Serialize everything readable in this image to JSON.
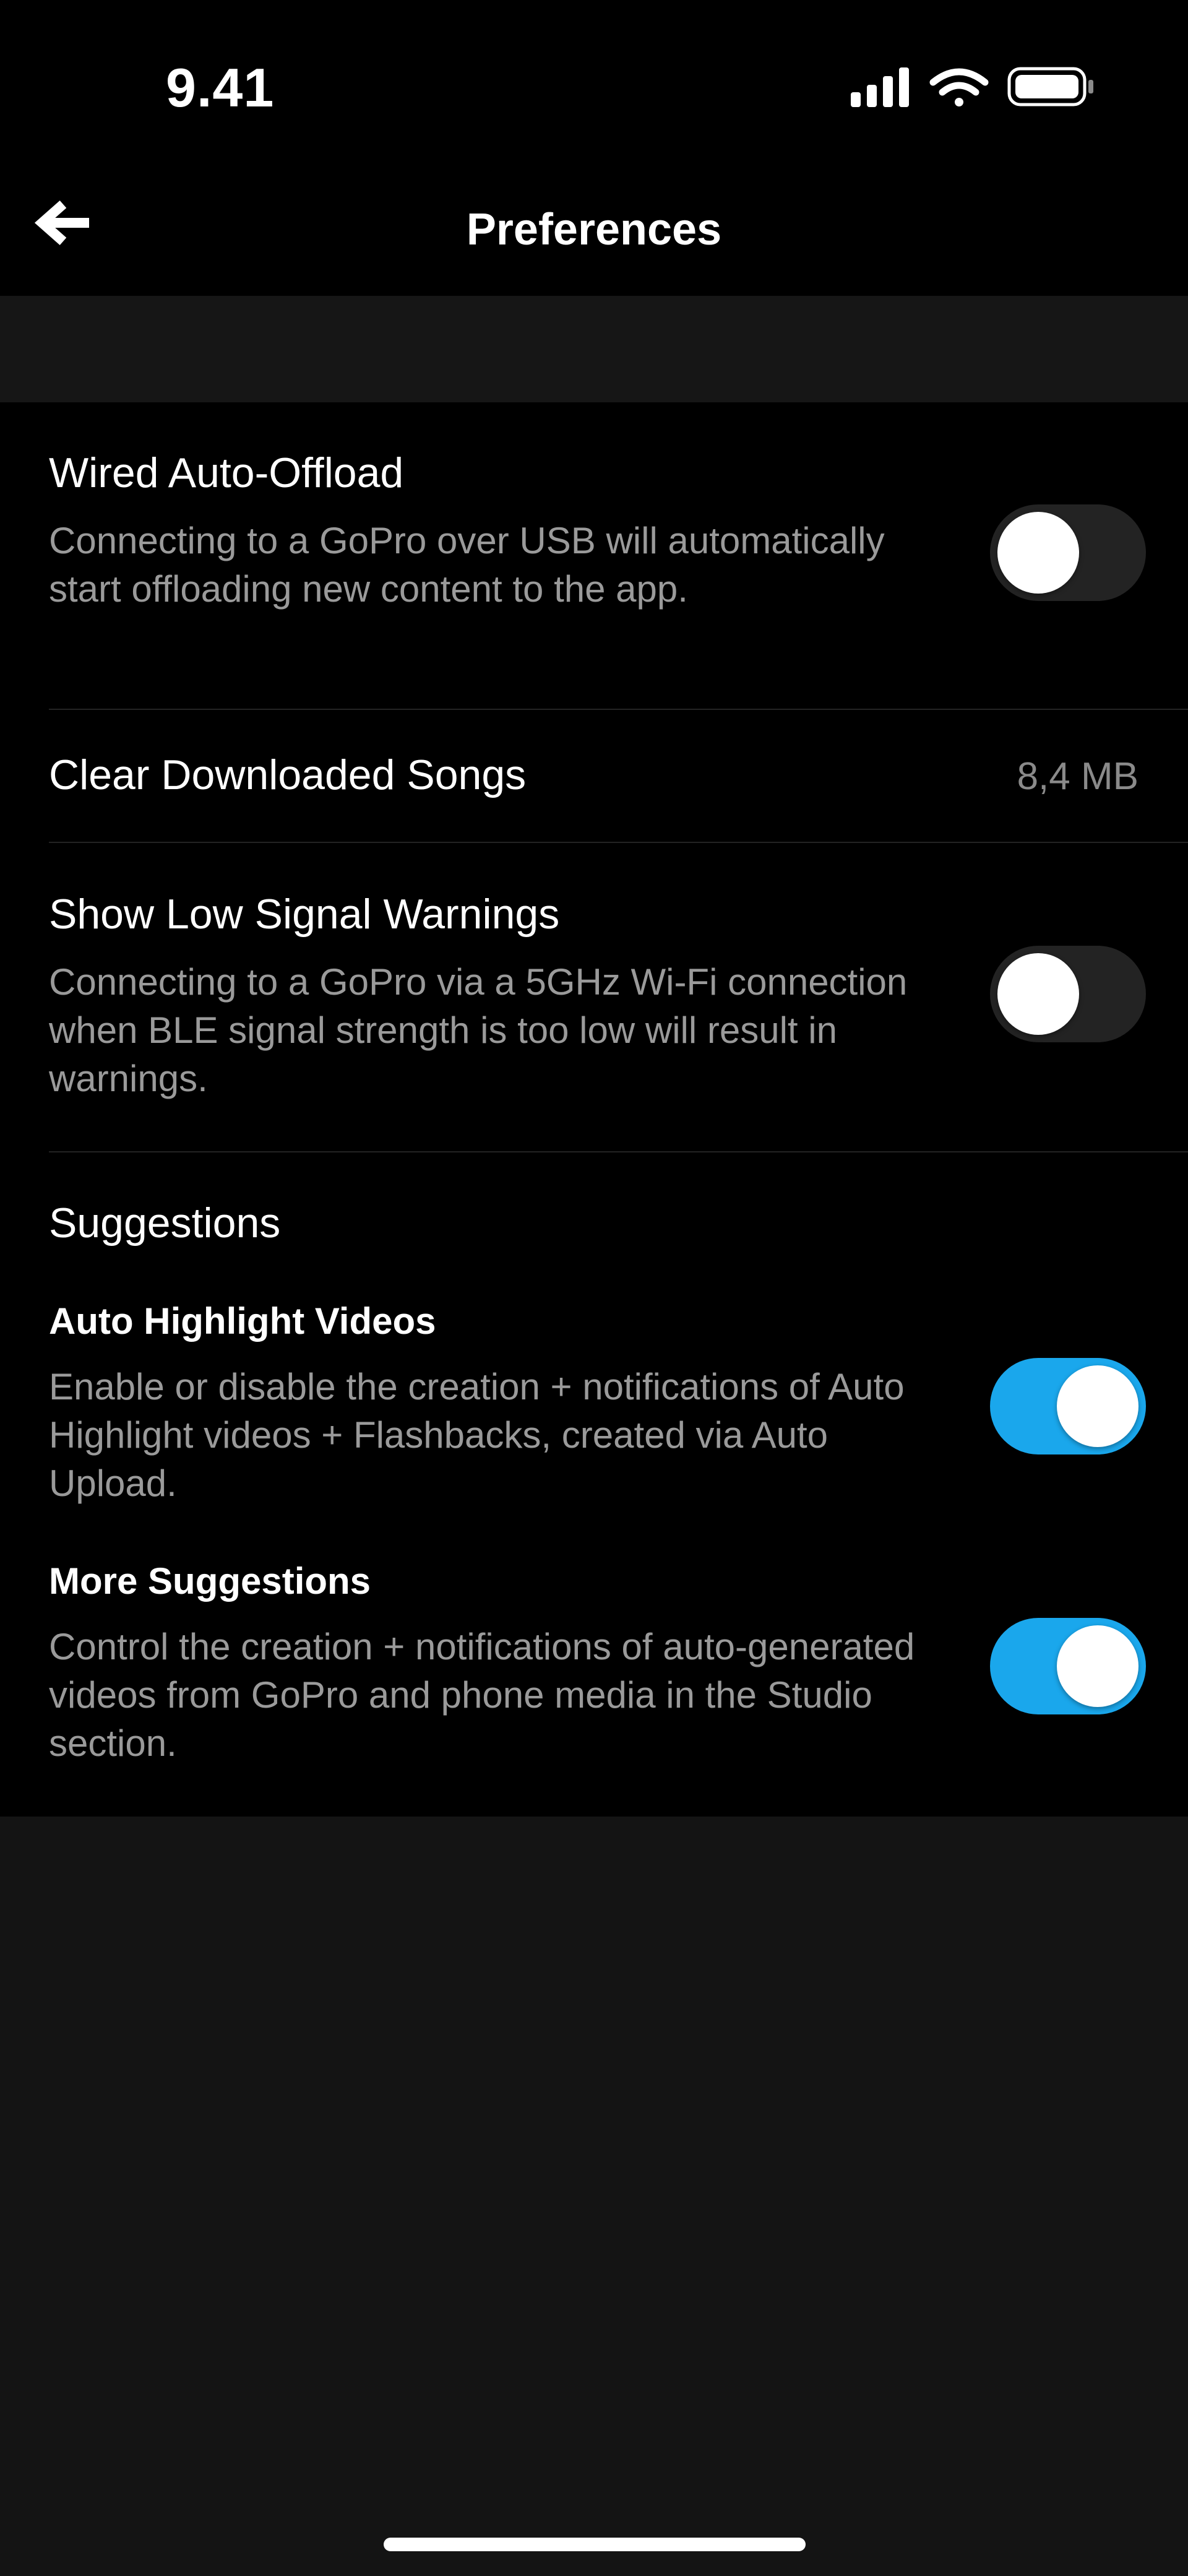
{
  "status_bar": {
    "time": "9.41",
    "icons": [
      "cellular-signal-icon",
      "wifi-icon",
      "battery-icon"
    ]
  },
  "nav": {
    "back_icon": "arrow-left-icon",
    "title": "Preferences"
  },
  "settings": {
    "wired_auto_offload": {
      "title": "Wired Auto-Offload",
      "description": "Connecting to a GoPro over USB will automatically start offloading new content to the app.",
      "enabled": false
    },
    "clear_songs": {
      "title": "Clear Downloaded Songs",
      "value": "8,4 MB"
    },
    "low_signal": {
      "title": "Show Low Signal Warnings",
      "description": "Connecting to a GoPro via a 5GHz Wi-Fi connection when BLE signal strength is too low will result in warnings.",
      "enabled": false
    },
    "suggestions": {
      "header": "Suggestions",
      "auto_highlight": {
        "title": "Auto Highlight Videos",
        "description": "Enable or disable the creation + notifications of Auto Highlight videos + Flashbacks, created via Auto Upload.",
        "enabled": true
      },
      "more_suggestions": {
        "title": "More Suggestions",
        "description": "Control the creation + notifications of auto-generated videos from GoPro and phone media in the Studio section.",
        "enabled": true
      }
    }
  },
  "colors": {
    "accent": "#1aa7ec",
    "background": "#000000",
    "page_background": "#141414",
    "secondary_text": "#9a9a9a"
  }
}
